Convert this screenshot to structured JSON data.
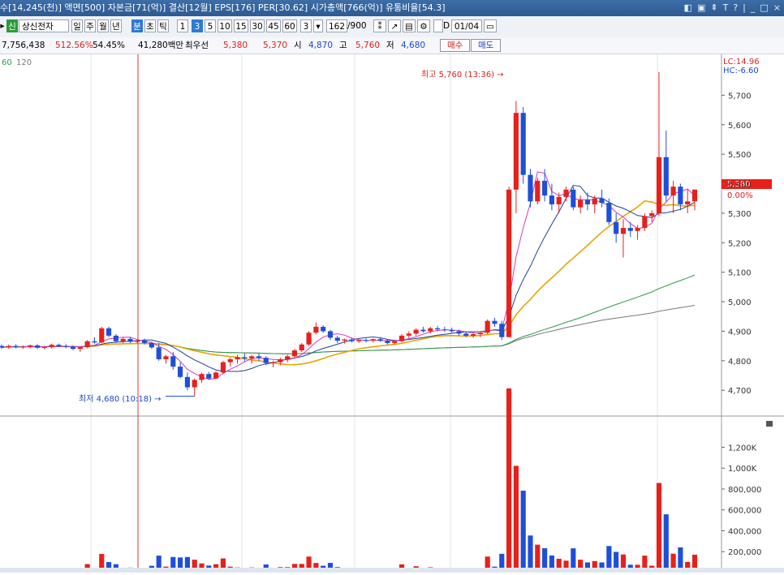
{
  "title_bar": {
    "text": "수[14,245(천)] 액면[500] 자본금[71(억)] 결산[12월] EPS[176] PER[30.62] 시가총액[766(억)] 유통비율[54.3]",
    "window_icons": [
      "◧",
      "▣",
      "⇞",
      "T",
      "?",
      "|",
      "_",
      "□",
      "×"
    ]
  },
  "toolbar": {
    "badge": "신",
    "stock_name": "상신전자",
    "period_buttons": [
      "일",
      "주",
      "월",
      "년",
      "분",
      "초",
      "틱"
    ],
    "interval_buttons": [
      "1",
      "3",
      "5",
      "10",
      "15",
      "30",
      "45",
      "60"
    ],
    "interval_dropdown": "3",
    "count": "162",
    "count_total": "/900",
    "checkbox_label": "D",
    "date": "01/04"
  },
  "info_bar": {
    "volume": "7,756,438",
    "rate1": "512.56%",
    "rate2": "54.45%",
    "amount": "41,280백만",
    "best_bid_label": "최우선",
    "best_bid_1": "5,380",
    "best_bid_2": "5,370",
    "open_label": "시",
    "open": "4,870",
    "high_label": "고",
    "high": "5,760",
    "low_label": "저",
    "low": "4,680",
    "buy_button": "매수",
    "sell_button": "매도"
  },
  "ma_legend": {
    "ma60": "60",
    "ma120": "120"
  },
  "annotations": {
    "high": "최고 5,760 (13:36) →",
    "low": "최저 4,680 (10:18) →",
    "lc": "LC:14.96",
    "hc": "HC:-6.60",
    "current_price": "5,380",
    "current_change": "0.00%"
  },
  "colors": {
    "up": "#e8201a",
    "down": "#1f4fd8",
    "ma5": "#d23ac8",
    "ma10": "#1f3f9e",
    "ma20": "#e9a400",
    "ma60": "#2f9a48",
    "ma120": "#7a7a7a"
  },
  "chart_data": {
    "type": "candlestick",
    "price_axis": {
      "ticks": [
        "5,700",
        "5,600",
        "5,500",
        "5,400",
        "5,300",
        "5,200",
        "5,100",
        "5,000",
        "4,900",
        "4,800",
        "4,700"
      ],
      "ylim": [
        4640,
        5800
      ]
    },
    "volume_axis": {
      "ticks": [
        "1,200K",
        "1,000K",
        "800,000",
        "600,000",
        "400,000",
        "200,000"
      ]
    },
    "candles": [
      [
        4850,
        4855,
        4840,
        4845
      ],
      [
        4845,
        4855,
        4840,
        4850
      ],
      [
        4850,
        4856,
        4842,
        4846
      ],
      [
        4846,
        4852,
        4840,
        4848
      ],
      [
        4848,
        4855,
        4842,
        4852
      ],
      [
        4852,
        4856,
        4840,
        4844
      ],
      [
        4844,
        4850,
        4838,
        4846
      ],
      [
        4846,
        4858,
        4842,
        4854
      ],
      [
        4854,
        4858,
        4846,
        4850
      ],
      [
        4850,
        4856,
        4842,
        4848
      ],
      [
        4848,
        4852,
        4836,
        4840
      ],
      [
        4840,
        4848,
        4830,
        4846
      ],
      [
        4846,
        4870,
        4842,
        4866
      ],
      [
        4866,
        4880,
        4858,
        4862
      ],
      [
        4862,
        4915,
        4860,
        4910
      ],
      [
        4910,
        4915,
        4880,
        4885
      ],
      [
        4885,
        4890,
        4860,
        4866
      ],
      [
        4866,
        4880,
        4860,
        4874
      ],
      [
        4874,
        4880,
        4860,
        4864
      ],
      [
        4864,
        4872,
        4858,
        4868
      ],
      [
        4868,
        4875,
        4855,
        4860
      ],
      [
        4860,
        4864,
        4840,
        4845
      ],
      [
        4845,
        4860,
        4800,
        4805
      ],
      [
        4805,
        4820,
        4790,
        4815
      ],
      [
        4815,
        4830,
        4770,
        4780
      ],
      [
        4780,
        4795,
        4740,
        4745
      ],
      [
        4745,
        4760,
        4700,
        4710
      ],
      [
        4710,
        4740,
        4680,
        4735
      ],
      [
        4735,
        4760,
        4725,
        4755
      ],
      [
        4755,
        4762,
        4735,
        4740
      ],
      [
        4740,
        4765,
        4738,
        4760
      ],
      [
        4760,
        4800,
        4755,
        4795
      ],
      [
        4795,
        4810,
        4780,
        4805
      ],
      [
        4805,
        4820,
        4790,
        4812
      ],
      [
        4812,
        4825,
        4798,
        4808
      ],
      [
        4808,
        4820,
        4790,
        4815
      ],
      [
        4815,
        4825,
        4800,
        4810
      ],
      [
        4810,
        4815,
        4785,
        4792
      ],
      [
        4792,
        4800,
        4778,
        4795
      ],
      [
        4795,
        4810,
        4785,
        4805
      ],
      [
        4805,
        4820,
        4795,
        4815
      ],
      [
        4815,
        4840,
        4810,
        4835
      ],
      [
        4835,
        4860,
        4830,
        4855
      ],
      [
        4855,
        4900,
        4850,
        4895
      ],
      [
        4895,
        4930,
        4890,
        4915
      ],
      [
        4915,
        4920,
        4895,
        4900
      ],
      [
        4900,
        4905,
        4870,
        4878
      ],
      [
        4878,
        4885,
        4860,
        4868
      ],
      [
        4868,
        4875,
        4858,
        4872
      ],
      [
        4872,
        4878,
        4862,
        4866
      ],
      [
        4866,
        4872,
        4860,
        4870
      ],
      [
        4870,
        4876,
        4862,
        4868
      ],
      [
        4868,
        4875,
        4862,
        4873
      ],
      [
        4873,
        4880,
        4864,
        4868
      ],
      [
        4868,
        4872,
        4855,
        4860
      ],
      [
        4860,
        4870,
        4855,
        4866
      ],
      [
        4866,
        4890,
        4862,
        4885
      ],
      [
        4885,
        4900,
        4875,
        4892
      ],
      [
        4892,
        4910,
        4885,
        4905
      ],
      [
        4905,
        4915,
        4895,
        4900
      ],
      [
        4900,
        4915,
        4892,
        4910
      ],
      [
        4910,
        4918,
        4900,
        4906
      ],
      [
        4906,
        4915,
        4898,
        4904
      ],
      [
        4904,
        4912,
        4895,
        4900
      ],
      [
        4900,
        4905,
        4885,
        4892
      ],
      [
        4892,
        4900,
        4880,
        4885
      ],
      [
        4885,
        4895,
        4878,
        4890
      ],
      [
        4890,
        4900,
        4880,
        4895
      ],
      [
        4895,
        4940,
        4890,
        4935
      ],
      [
        4935,
        4945,
        4915,
        4925
      ],
      [
        4925,
        4935,
        4870,
        4880
      ],
      [
        4880,
        5390,
        4880,
        5380
      ],
      [
        5380,
        5680,
        5300,
        5640
      ],
      [
        5640,
        5660,
        5400,
        5430
      ],
      [
        5430,
        5450,
        5320,
        5340
      ],
      [
        5340,
        5420,
        5330,
        5410
      ],
      [
        5410,
        5450,
        5340,
        5360
      ],
      [
        5360,
        5400,
        5310,
        5330
      ],
      [
        5330,
        5370,
        5300,
        5355
      ],
      [
        5355,
        5390,
        5340,
        5380
      ],
      [
        5380,
        5390,
        5310,
        5320
      ],
      [
        5320,
        5360,
        5300,
        5345
      ],
      [
        5345,
        5370,
        5310,
        5330
      ],
      [
        5330,
        5360,
        5300,
        5350
      ],
      [
        5350,
        5380,
        5320,
        5335
      ],
      [
        5335,
        5350,
        5260,
        5270
      ],
      [
        5270,
        5300,
        5200,
        5230
      ],
      [
        5230,
        5280,
        5150,
        5250
      ],
      [
        5250,
        5270,
        5220,
        5240
      ],
      [
        5240,
        5260,
        5210,
        5250
      ],
      [
        5250,
        5300,
        5240,
        5290
      ],
      [
        5290,
        5310,
        5270,
        5300
      ],
      [
        5300,
        5690,
        5290,
        5490
      ],
      [
        5490,
        5580,
        5340,
        5360
      ],
      [
        5360,
        5410,
        5300,
        5390
      ],
      [
        5390,
        5400,
        5310,
        5330
      ],
      [
        5330,
        5380,
        5300,
        5340
      ],
      [
        5340,
        5380,
        5310,
        5380
      ]
    ]
  }
}
